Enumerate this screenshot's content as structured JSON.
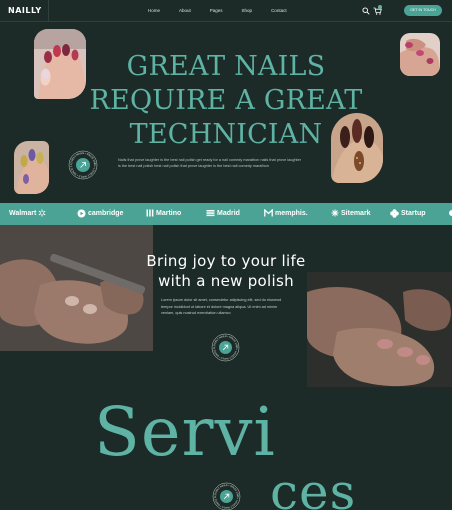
{
  "header": {
    "logo": "NAILLY",
    "nav": [
      "Home",
      "About",
      "Pages",
      "Shop",
      "Contact"
    ],
    "cta_label": "GET IN TOUCH"
  },
  "hero": {
    "headline_line1": "GREAT NAILS",
    "headline_line2": "REQUIRE A GREAT",
    "headline_line3": "TECHNICIAN",
    "text_line1": "Nails that prove laughter is the best nail polish get ready for a nail comedy marathon nails that prove laughter",
    "text_line2": "is the best nail polish best nail polish that prove laughter is the best nail comedy marathon"
  },
  "badge": {
    "ring_text": "LOVELY NAILS • SINCE 1990 • LOVELY NAILS • SINCE 1990 •"
  },
  "brands": [
    "Walmart",
    "cambridge",
    "Martino",
    "Madrid",
    "memphis.",
    "Sitemark",
    "Startup"
  ],
  "about": {
    "headline_line1": "Bring joy to your life",
    "headline_line2": "with a new polish",
    "text": "Lorem ipsum dolor sit amet, consectetur adipiscing elit, sed do eiusmod tempor incididunt ut labore et dolore magna aliqua. Ut enim ad minim veniam, quis nostrud exercitation ullamco"
  },
  "services": {
    "part1": "Servi",
    "part2": "ces"
  },
  "colors": {
    "background": "#1c2b27",
    "accent": "#5fb3a5",
    "strip": "#4aa395"
  },
  "icons": {
    "search": "search-icon",
    "cart": "cart-icon",
    "badge": "arrow-up-right-icon"
  }
}
